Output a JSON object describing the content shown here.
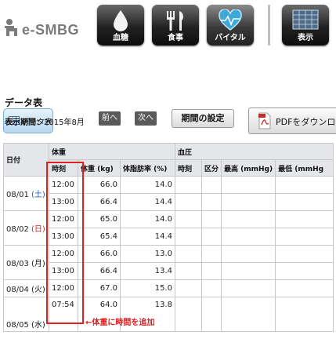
{
  "app": {
    "title": "e-SMBG"
  },
  "nav": [
    {
      "name": "blood-sugar",
      "label": "血糖",
      "icon": "drop-icon"
    },
    {
      "name": "meal",
      "label": "食事",
      "icon": "fork-knife-icon"
    },
    {
      "name": "vital",
      "label": "バイタル",
      "icon": "heart-icon"
    },
    {
      "name": "display",
      "label": "表示",
      "icon": "grid-icon"
    }
  ],
  "subnav": {
    "datatable_label": "データ表"
  },
  "page": {
    "title": "データ表",
    "period_label": "表示期間：",
    "period_value": "2015年8月",
    "prev_label": "前へ",
    "next_label": "次へ",
    "period_setting_label": "期間の設定",
    "pdf_label": "PDFをダウンロ"
  },
  "table": {
    "group_headers": {
      "date": "日付",
      "weight": "体重",
      "bp": "血圧"
    },
    "columns": {
      "time": "時刻",
      "weight": "体重 (kg)",
      "bodyfat": "体脂肪率 (%)",
      "bp_time": "時刻",
      "category": "区分",
      "max": "最高 (mmHg)",
      "min": "最低 (mmHg"
    },
    "days": [
      {
        "date": "08/01",
        "weekday": "(土)",
        "weekday_color": "#1a50b8",
        "rows": [
          {
            "time": "12:00",
            "weight": "66.0",
            "bodyfat": "14.0"
          },
          {
            "time": "13:00",
            "weight": "66.4",
            "bodyfat": "14.4"
          }
        ]
      },
      {
        "date": "08/02",
        "weekday": "(日)",
        "weekday_color": "#dd2222",
        "rows": [
          {
            "time": "12:00",
            "weight": "65.0",
            "bodyfat": "14.0"
          },
          {
            "time": "13:00",
            "weight": "65.4",
            "bodyfat": "14.4"
          }
        ]
      },
      {
        "date": "08/03",
        "weekday": "(月)",
        "weekday_color": "#111111",
        "rows": [
          {
            "time": "12:00",
            "weight": "66.0",
            "bodyfat": "13.0"
          },
          {
            "time": "13:00",
            "weight": "66.4",
            "bodyfat": "13.4"
          }
        ]
      },
      {
        "date": "08/04",
        "weekday": "(火)",
        "weekday_color": "#111111",
        "rows": [
          {
            "time": "12:00",
            "weight": "67.0",
            "bodyfat": "15.0"
          }
        ]
      },
      {
        "date": "08/05",
        "weekday": "(水)",
        "weekday_color": "#111111",
        "rows": [
          {
            "time": "07:54",
            "weight": "64.0",
            "bodyfat": "13.8"
          }
        ]
      }
    ]
  },
  "annotation": {
    "text": "←体重に時間を追加",
    "color": "#e02020"
  }
}
